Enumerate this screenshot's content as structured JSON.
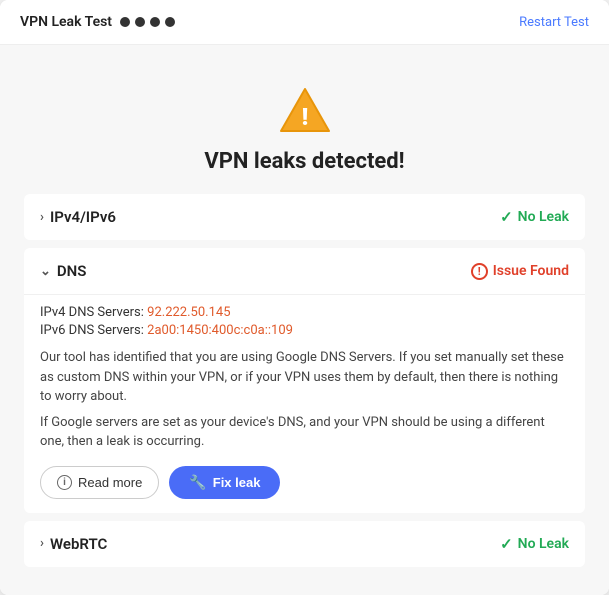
{
  "header": {
    "title": "VPN Leak Test",
    "restart_label": "Restart Test"
  },
  "warning": {
    "title": "VPN leaks detected!"
  },
  "sections": [
    {
      "id": "ipv4ipv6",
      "label": "IPv4/IPv6",
      "collapsed": true,
      "status": "no_leak",
      "status_label": "No Leak"
    },
    {
      "id": "dns",
      "label": "DNS",
      "collapsed": false,
      "status": "issue",
      "status_label": "Issue Found",
      "ipv4_server_label": "IPv4 DNS Servers:",
      "ipv4_server_value": "92.222.50.145",
      "ipv6_server_label": "IPv6 DNS Servers:",
      "ipv6_server_value": "2a00:1450:400c:c0a::109",
      "description_1": "Our tool has identified that you are using Google DNS Servers. If you set manually set these as custom DNS within your VPN, or if your VPN uses them by default, then there is nothing to worry about.",
      "description_2": "If Google servers are set as your device's DNS, and your VPN should be using a different one, then a leak is occurring.",
      "read_more_label": "Read more",
      "fix_leak_label": "Fix leak"
    },
    {
      "id": "webrtc",
      "label": "WebRTC",
      "collapsed": true,
      "status": "no_leak",
      "status_label": "No Leak"
    }
  ]
}
